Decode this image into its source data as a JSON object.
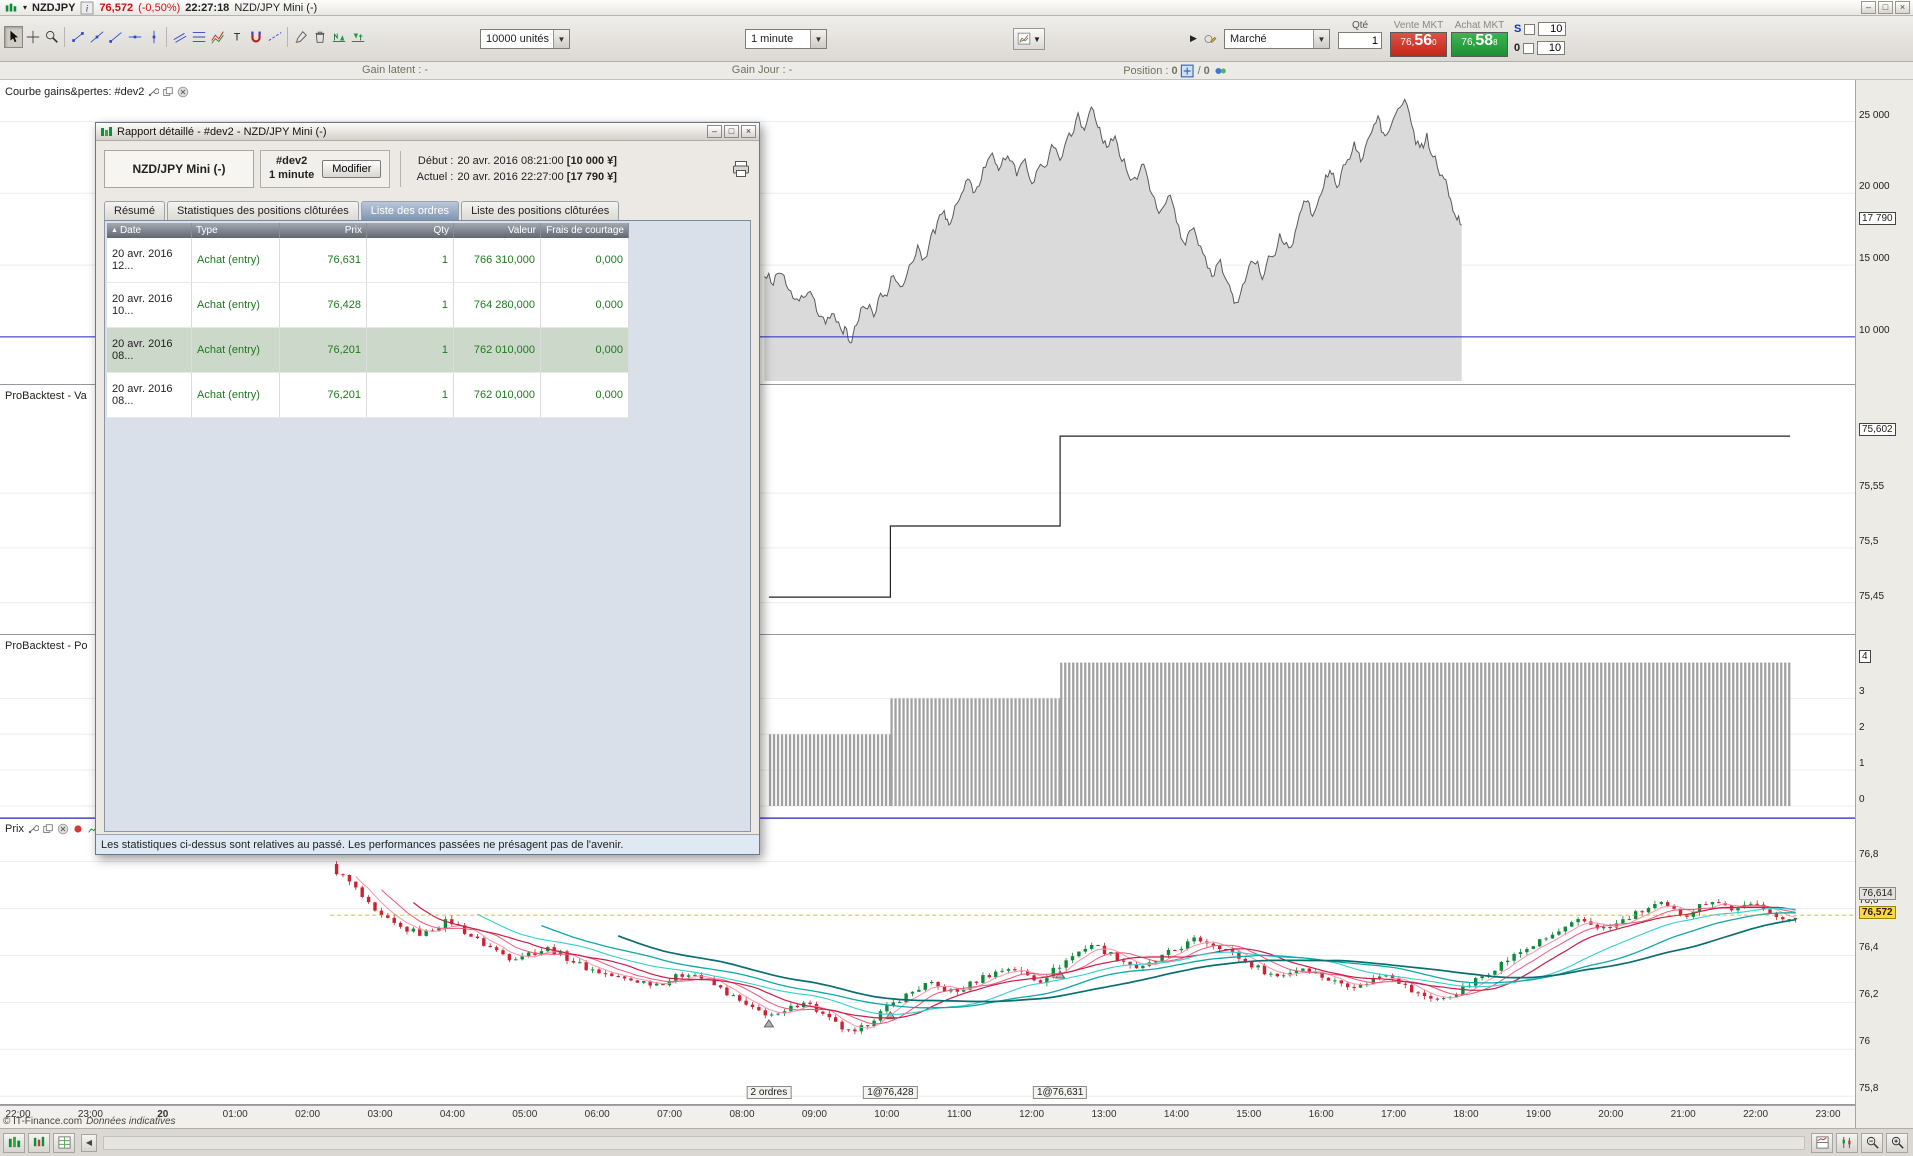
{
  "title_bar": {
    "symbol": "NZDJPY",
    "price": "76,572",
    "change": "(-0,50%)",
    "clock": "22:27:18",
    "instrument": "NZD/JPY Mini (-)"
  },
  "toolbar": {
    "tools": [
      "pointer-tool",
      "crosshair-tool",
      "zoom-tool",
      "segment-tool",
      "line-tool",
      "ray-tool",
      "horizontal-line-tool",
      "vertical-line-tool",
      "parallel-lines-tool",
      "fibonacci-tool",
      "zigzag-tool",
      "text-tool",
      "magnet-tool",
      "dashed-line-tool",
      "settings-tool",
      "trash-tool",
      "bull-pattern-indicator",
      "bear-pattern-indicator"
    ],
    "units": "10000 unités",
    "timeframe": "1 minute",
    "order_type": "Marché",
    "qty_label": "Qté",
    "qty": "1",
    "sell_label": "Vente MKT",
    "buy_label": "Achat MKT",
    "sell_prefix": "76,",
    "sell_big": "56",
    "sell_sup": "0",
    "buy_prefix": "76,",
    "buy_big": "58",
    "buy_sup": "8",
    "stop": {
      "label": "S",
      "value": "10"
    },
    "limit": {
      "label": "0",
      "value": "10"
    }
  },
  "status": {
    "gain_latent_label": "Gain latent :",
    "gain_latent_value": "-",
    "gain_jour_label": "Gain Jour :",
    "gain_jour_value": "-",
    "position_label": "Position :",
    "position_open": "0",
    "position_sep": "/",
    "position_orders": "0"
  },
  "pane_titles": {
    "equity": {
      "label": "Courbe gains&pertes: #dev2",
      "icons": [
        "wrench-icon",
        "copy-icon",
        "close-icon"
      ]
    },
    "valuation": {
      "label": "ProBacktest - Va"
    },
    "position": {
      "label": "ProBacktest - Po"
    },
    "price": {
      "label": "Prix",
      "icons": [
        "wrench-icon",
        "copy-icon",
        "close-icon",
        "record-icon",
        "chart-mini-icon"
      ]
    }
  },
  "report_dialog": {
    "title": "Rapport détaillé - #dev2 - NZD/JPY Mini (-)",
    "instrument": "NZD/JPY Mini (-)",
    "system": "#dev2",
    "timeframe": "1 minute",
    "modify_button": "Modifier",
    "start_label": "Début :",
    "start_value": "20 avr. 2016 08:21:00",
    "start_amount": "[10 000 ¥]",
    "current_label": "Actuel :",
    "current_value": "20 avr. 2016 22:27:00",
    "current_amount": "[17 790 ¥]",
    "tabs": [
      "Résumé",
      "Statistiques des positions clôturées",
      "Liste des ordres",
      "Liste des positions clôturées"
    ],
    "active_tab": "Liste des ordres",
    "table": {
      "columns": [
        "Date",
        "Type",
        "Prix",
        "Qty",
        "Valeur",
        "Frais de courtage"
      ],
      "rows": [
        [
          "20 avr. 2016 12...",
          "Achat (entry)",
          "76,631",
          "1",
          "766 310,000",
          "0,000"
        ],
        [
          "20 avr. 2016 10...",
          "Achat (entry)",
          "76,428",
          "1",
          "764 280,000",
          "0,000"
        ],
        [
          "20 avr. 2016 08...",
          "Achat (entry)",
          "76,201",
          "1",
          "762 010,000",
          "0,000"
        ],
        [
          "20 avr. 2016 08...",
          "Achat (entry)",
          "76,201",
          "1",
          "762 010,000",
          "0,000"
        ]
      ],
      "highlighted_row": 2
    },
    "disclaimer": "Les statistiques ci-dessus sont relatives au passé. Les performances passées ne présagent pas de l'avenir."
  },
  "xaxis": {
    "labels": [
      "22:00",
      "23:00",
      "20",
      "01:00",
      "02:00",
      "03:00",
      "04:00",
      "05:00",
      "06:00",
      "07:00",
      "08:00",
      "09:00",
      "10:00",
      "11:00",
      "12:00",
      "13:00",
      "14:00",
      "15:00",
      "16:00",
      "17:00",
      "18:00",
      "19:00",
      "20:00",
      "21:00",
      "22:00",
      "23:00"
    ],
    "bold_index": 2
  },
  "copyright": {
    "line1": "© IT-Finance.com",
    "line2": "Données indicatives"
  },
  "colors": {
    "sell_button": "#c22718",
    "buy_button": "#1d8f33",
    "price_up": "#0f8a3a",
    "price_down": "#cc2233",
    "baseline_blue": "#2424c8",
    "current_price_tag": "#ffd83d",
    "equity_fill": "#dadada",
    "bars_gray": "#a2a2a2"
  },
  "chart_data": [
    {
      "type": "area",
      "name": "equity-curve",
      "title": "Courbe gains&pertes: #dev2",
      "ylim": [
        7000,
        26500
      ],
      "xrange": [
        0.412,
        0.788
      ],
      "baseline": 10000,
      "final_value": 17790,
      "ticks": [
        {
          "v": 25000,
          "label": "25 000"
        },
        {
          "v": 20000,
          "label": "20 000"
        },
        {
          "v": 15000,
          "label": "15 000"
        },
        {
          "v": 10000,
          "label": "10 000"
        }
      ],
      "current_tag": {
        "v": 17790,
        "label": "17 790"
      },
      "points": [
        [
          0,
          14200
        ],
        [
          0.013,
          13600
        ],
        [
          0.025,
          14400
        ],
        [
          0.038,
          13200
        ],
        [
          0.05,
          12500
        ],
        [
          0.063,
          13100
        ],
        [
          0.075,
          11800
        ],
        [
          0.088,
          10900
        ],
        [
          0.1,
          11600
        ],
        [
          0.113,
          10200
        ],
        [
          0.123,
          9600
        ],
        [
          0.132,
          10800
        ],
        [
          0.145,
          12000
        ],
        [
          0.157,
          11400
        ],
        [
          0.17,
          12800
        ],
        [
          0.182,
          14200
        ],
        [
          0.195,
          13500
        ],
        [
          0.208,
          15000
        ],
        [
          0.22,
          16400
        ],
        [
          0.233,
          15600
        ],
        [
          0.245,
          17200
        ],
        [
          0.258,
          18800
        ],
        [
          0.267,
          17900
        ],
        [
          0.28,
          19600
        ],
        [
          0.292,
          21000
        ],
        [
          0.302,
          20100
        ],
        [
          0.314,
          21800
        ],
        [
          0.327,
          22800
        ],
        [
          0.336,
          21600
        ],
        [
          0.349,
          22600
        ],
        [
          0.362,
          21200
        ],
        [
          0.374,
          22400
        ],
        [
          0.387,
          20800
        ],
        [
          0.399,
          21900
        ],
        [
          0.412,
          23400
        ],
        [
          0.424,
          22300
        ],
        [
          0.437,
          24200
        ],
        [
          0.45,
          25600
        ],
        [
          0.459,
          24400
        ],
        [
          0.472,
          25800
        ],
        [
          0.481,
          24600
        ],
        [
          0.491,
          23200
        ],
        [
          0.503,
          24000
        ],
        [
          0.516,
          22400
        ],
        [
          0.528,
          21000
        ],
        [
          0.541,
          22000
        ],
        [
          0.553,
          20200
        ],
        [
          0.566,
          18600
        ],
        [
          0.579,
          19800
        ],
        [
          0.591,
          18000
        ],
        [
          0.604,
          16400
        ],
        [
          0.616,
          17600
        ],
        [
          0.629,
          15800
        ],
        [
          0.642,
          14200
        ],
        [
          0.654,
          15400
        ],
        [
          0.667,
          13600
        ],
        [
          0.676,
          12400
        ],
        [
          0.689,
          13800
        ],
        [
          0.701,
          15200
        ],
        [
          0.714,
          14000
        ],
        [
          0.726,
          15600
        ],
        [
          0.739,
          17200
        ],
        [
          0.752,
          16200
        ],
        [
          0.764,
          17800
        ],
        [
          0.777,
          19400
        ],
        [
          0.786,
          18400
        ],
        [
          0.799,
          20000
        ],
        [
          0.811,
          21600
        ],
        [
          0.821,
          20400
        ],
        [
          0.833,
          22000
        ],
        [
          0.846,
          23600
        ],
        [
          0.855,
          22200
        ],
        [
          0.868,
          24000
        ],
        [
          0.88,
          25400
        ],
        [
          0.89,
          24000
        ],
        [
          0.902,
          25200
        ],
        [
          0.915,
          26200
        ],
        [
          0.928,
          24800
        ],
        [
          0.94,
          23200
        ],
        [
          0.95,
          24200
        ],
        [
          0.962,
          22600
        ],
        [
          0.975,
          21000
        ],
        [
          0.984,
          19600
        ],
        [
          0.991,
          18400
        ],
        [
          1,
          17790
        ]
      ]
    },
    {
      "type": "step",
      "name": "strategy-valuation",
      "title": "ProBacktest - Va",
      "ylim": [
        75.425,
        75.635
      ],
      "ticks": [
        {
          "v": 75.55,
          "label": "75,55"
        },
        {
          "v": 75.5,
          "label": "75,5"
        },
        {
          "v": 75.45,
          "label": "75,45"
        }
      ],
      "current_tag": {
        "v": 75.602,
        "label": "75,602"
      },
      "steps": [
        {
          "from": 0.4145,
          "to": 0.48,
          "v": 75.455
        },
        {
          "from": 0.48,
          "to": 0.5715,
          "v": 75.52
        },
        {
          "from": 0.5715,
          "to": 0.965,
          "v": 75.602
        }
      ]
    },
    {
      "type": "bar",
      "name": "position-size",
      "title": "ProBacktest - Po",
      "ylim": [
        0,
        4.35
      ],
      "ticks": [
        {
          "v": 3,
          "label": "3"
        },
        {
          "v": 2,
          "label": "2"
        },
        {
          "v": 1,
          "label": "1"
        },
        {
          "v": 0,
          "label": "0"
        }
      ],
      "current_tag": {
        "v": 4,
        "label": "4"
      },
      "segments": [
        {
          "from": 0.4145,
          "to": 0.48,
          "qty": 2
        },
        {
          "from": 0.48,
          "to": 0.5715,
          "qty": 3
        },
        {
          "from": 0.5715,
          "to": 0.965,
          "qty": 4
        }
      ]
    },
    {
      "type": "candlestick",
      "name": "price",
      "title": "Prix",
      "ylim": [
        75.78,
        76.93
      ],
      "last_price": 76.572,
      "ticks": [
        {
          "v": 76.8,
          "label": "76,8"
        },
        {
          "v": 76.6,
          "label": "76,6"
        },
        {
          "v": 76.4,
          "label": "76,4"
        },
        {
          "v": 76.2,
          "label": "76,2"
        },
        {
          "v": 76.0,
          "label": "76"
        },
        {
          "v": 75.8,
          "label": "75,8"
        }
      ],
      "tags": [
        {
          "v": 76.614,
          "label": "76,614",
          "style": "gray"
        },
        {
          "v": 76.572,
          "label": "76,572",
          "style": "yellow"
        }
      ],
      "keypoints": [
        [
          0.178,
          76.78
        ],
        [
          0.19,
          76.7
        ],
        [
          0.202,
          76.58
        ],
        [
          0.215,
          76.52
        ],
        [
          0.228,
          76.49
        ],
        [
          0.242,
          76.55
        ],
        [
          0.258,
          76.46
        ],
        [
          0.275,
          76.39
        ],
        [
          0.296,
          76.43
        ],
        [
          0.315,
          76.35
        ],
        [
          0.335,
          76.3
        ],
        [
          0.355,
          76.28
        ],
        [
          0.372,
          76.33
        ],
        [
          0.39,
          76.25
        ],
        [
          0.405,
          76.17
        ],
        [
          0.42,
          76.14
        ],
        [
          0.433,
          76.21
        ],
        [
          0.448,
          76.12
        ],
        [
          0.46,
          76.06
        ],
        [
          0.472,
          76.14
        ],
        [
          0.486,
          76.22
        ],
        [
          0.5,
          76.28
        ],
        [
          0.515,
          76.24
        ],
        [
          0.53,
          76.31
        ],
        [
          0.545,
          76.35
        ],
        [
          0.56,
          76.29
        ],
        [
          0.575,
          76.38
        ],
        [
          0.588,
          76.45
        ],
        [
          0.6,
          76.4
        ],
        [
          0.615,
          76.34
        ],
        [
          0.63,
          76.41
        ],
        [
          0.645,
          76.47
        ],
        [
          0.658,
          76.44
        ],
        [
          0.672,
          76.37
        ],
        [
          0.688,
          76.31
        ],
        [
          0.703,
          76.35
        ],
        [
          0.718,
          76.29
        ],
        [
          0.733,
          76.27
        ],
        [
          0.748,
          76.33
        ],
        [
          0.762,
          76.24
        ],
        [
          0.778,
          76.21
        ],
        [
          0.793,
          76.28
        ],
        [
          0.808,
          76.36
        ],
        [
          0.823,
          76.43
        ],
        [
          0.838,
          76.49
        ],
        [
          0.852,
          76.55
        ],
        [
          0.866,
          76.51
        ],
        [
          0.88,
          76.57
        ],
        [
          0.894,
          76.62
        ],
        [
          0.908,
          76.57
        ],
        [
          0.922,
          76.64
        ],
        [
          0.936,
          76.59
        ],
        [
          0.948,
          76.63
        ],
        [
          0.958,
          76.55
        ],
        [
          0.968,
          76.57
        ]
      ],
      "markers": [
        {
          "x": 0.4145,
          "label": "2 ordres"
        },
        {
          "x": 0.48,
          "label": "1@76,428"
        },
        {
          "x": 0.5715,
          "label": "1@76,631"
        }
      ]
    }
  ],
  "bottom_bar": {
    "left_icons": [
      "portfolio-chart-icon",
      "orders-chart-icon",
      "data-table-icon"
    ],
    "right_icons": [
      "chart-layout-icon",
      "candlestick-view-icon",
      "zoom-out-icon",
      "zoom-in-icon"
    ]
  }
}
